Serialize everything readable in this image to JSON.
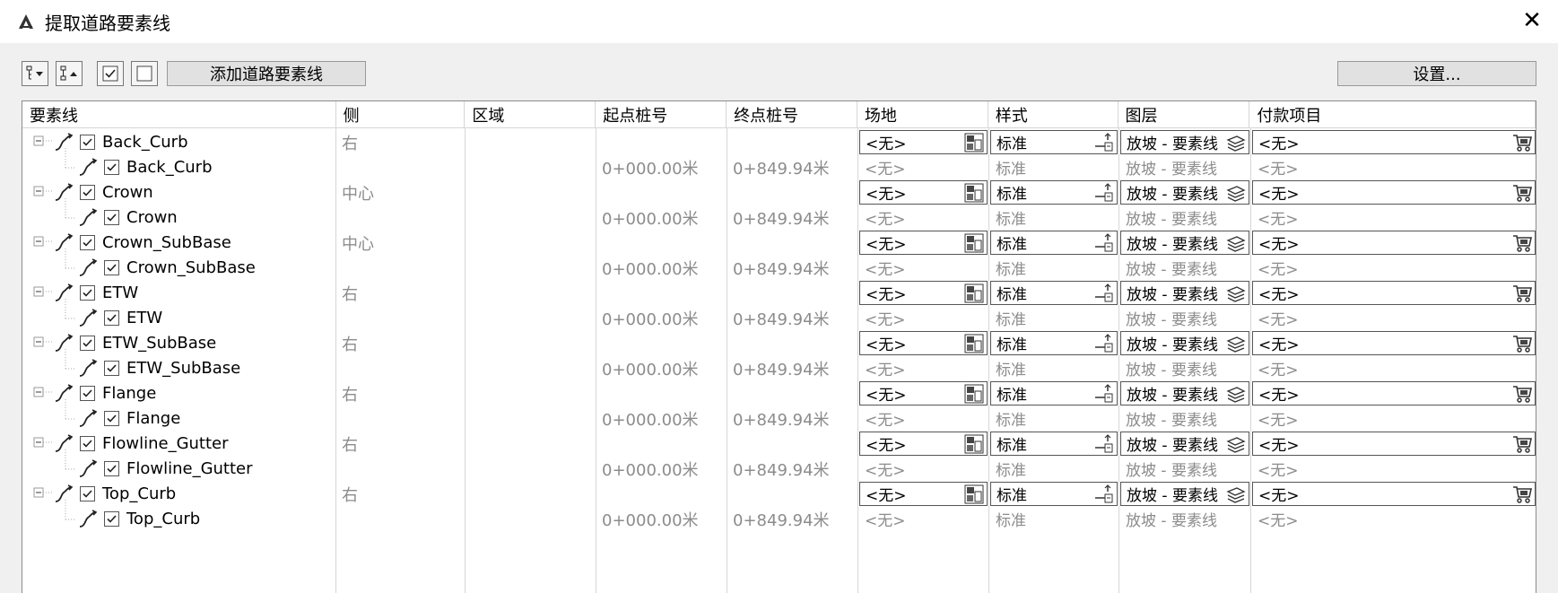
{
  "window": {
    "title": "提取道路要素线",
    "close_label": "✕"
  },
  "toolbar": {
    "expand_icon": "tree-expand-icon",
    "collapse_icon": "tree-collapse-icon",
    "check_all_icon": "check-all-icon",
    "uncheck_all_icon": "uncheck-all-icon",
    "add_label": "添加道路要素线",
    "settings_label": "设置..."
  },
  "columns": [
    "要素线",
    "侧",
    "区域",
    "起点桩号",
    "终点桩号",
    "场地",
    "样式",
    "图层",
    "付款项目"
  ],
  "rows": [
    {
      "level": 0,
      "name": "Back_Curb",
      "side": "右",
      "region": "",
      "start": "",
      "end": "",
      "site": "<无>",
      "style": "标准",
      "layer": "放坡 - 要素线",
      "pay": "<无>"
    },
    {
      "level": 1,
      "name": "Back_Curb",
      "side": "",
      "region": "",
      "start": "0+000.00米",
      "end": "0+849.94米",
      "site": "<无>",
      "style": "标准",
      "layer": "放坡 - 要素线",
      "pay": "<无>"
    },
    {
      "level": 0,
      "name": "Crown",
      "side": "中心",
      "region": "",
      "start": "",
      "end": "",
      "site": "<无>",
      "style": "标准",
      "layer": "放坡 - 要素线",
      "pay": "<无>"
    },
    {
      "level": 1,
      "name": "Crown",
      "side": "",
      "region": "",
      "start": "0+000.00米",
      "end": "0+849.94米",
      "site": "<无>",
      "style": "标准",
      "layer": "放坡 - 要素线",
      "pay": "<无>"
    },
    {
      "level": 0,
      "name": "Crown_SubBase",
      "side": "中心",
      "region": "",
      "start": "",
      "end": "",
      "site": "<无>",
      "style": "标准",
      "layer": "放坡 - 要素线",
      "pay": "<无>"
    },
    {
      "level": 1,
      "name": "Crown_SubBase",
      "side": "",
      "region": "",
      "start": "0+000.00米",
      "end": "0+849.94米",
      "site": "<无>",
      "style": "标准",
      "layer": "放坡 - 要素线",
      "pay": "<无>"
    },
    {
      "level": 0,
      "name": "ETW",
      "side": "右",
      "region": "",
      "start": "",
      "end": "",
      "site": "<无>",
      "style": "标准",
      "layer": "放坡 - 要素线",
      "pay": "<无>"
    },
    {
      "level": 1,
      "name": "ETW",
      "side": "",
      "region": "",
      "start": "0+000.00米",
      "end": "0+849.94米",
      "site": "<无>",
      "style": "标准",
      "layer": "放坡 - 要素线",
      "pay": "<无>"
    },
    {
      "level": 0,
      "name": "ETW_SubBase",
      "side": "右",
      "region": "",
      "start": "",
      "end": "",
      "site": "<无>",
      "style": "标准",
      "layer": "放坡 - 要素线",
      "pay": "<无>"
    },
    {
      "level": 1,
      "name": "ETW_SubBase",
      "side": "",
      "region": "",
      "start": "0+000.00米",
      "end": "0+849.94米",
      "site": "<无>",
      "style": "标准",
      "layer": "放坡 - 要素线",
      "pay": "<无>"
    },
    {
      "level": 0,
      "name": "Flange",
      "side": "右",
      "region": "",
      "start": "",
      "end": "",
      "site": "<无>",
      "style": "标准",
      "layer": "放坡 - 要素线",
      "pay": "<无>"
    },
    {
      "level": 1,
      "name": "Flange",
      "side": "",
      "region": "",
      "start": "0+000.00米",
      "end": "0+849.94米",
      "site": "<无>",
      "style": "标准",
      "layer": "放坡 - 要素线",
      "pay": "<无>"
    },
    {
      "level": 0,
      "name": "Flowline_Gutter",
      "side": "右",
      "region": "",
      "start": "",
      "end": "",
      "site": "<无>",
      "style": "标准",
      "layer": "放坡 - 要素线",
      "pay": "<无>"
    },
    {
      "level": 1,
      "name": "Flowline_Gutter",
      "side": "",
      "region": "",
      "start": "0+000.00米",
      "end": "0+849.94米",
      "site": "<无>",
      "style": "标准",
      "layer": "放坡 - 要素线",
      "pay": "<无>"
    },
    {
      "level": 0,
      "name": "Top_Curb",
      "side": "右",
      "region": "",
      "start": "",
      "end": "",
      "site": "<无>",
      "style": "标准",
      "layer": "放坡 - 要素线",
      "pay": "<无>"
    },
    {
      "level": 1,
      "name": "Top_Curb",
      "side": "",
      "region": "",
      "start": "0+000.00米",
      "end": "0+849.94米",
      "site": "<无>",
      "style": "标准",
      "layer": "放坡 - 要素线",
      "pay": "<无>"
    }
  ]
}
